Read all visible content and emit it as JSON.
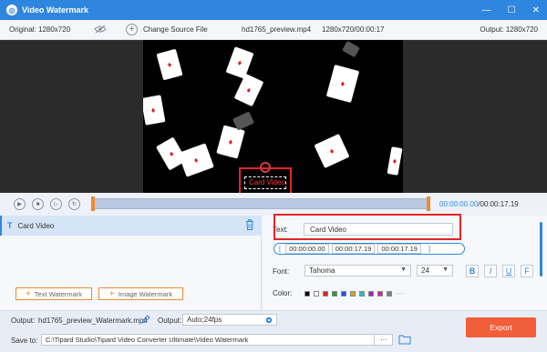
{
  "window": {
    "title": "Video Watermark",
    "controls": [
      "—",
      "☐",
      "✕"
    ]
  },
  "info": {
    "original": "Original: 1280x720",
    "change_source": "Change Source File",
    "filename": "hd1765_preview.mp4",
    "meta": "1280x720/00:00:17",
    "output_res": "Output: 1280x720"
  },
  "preview": {
    "watermark_text": "Card Video"
  },
  "playback": {
    "current": "00:00:00.00",
    "total": "/00:00:17.19"
  },
  "watermark_list": {
    "type_icon": "T",
    "items": [
      "Card Video"
    ]
  },
  "buttons": {
    "text_watermark": "Text Watermark",
    "image_watermark": "Image Watermark",
    "export": "Export"
  },
  "settings": {
    "text_label": "Text:",
    "text_value": "Card Video",
    "start": "00:00:00.00",
    "duration": "00:00:17.19",
    "end": "00:00:17.19",
    "font_label": "Font:",
    "font_value": "Tahoma",
    "size_value": "24",
    "color_label": "Color:",
    "bold": "B",
    "italic": "I",
    "underline": "U",
    "strike": "F",
    "colors": [
      "#000000",
      "#ffffff",
      "#e02020",
      "#20a020",
      "#2050e0",
      "#e0a020",
      "#20c0c0",
      "#a020c0",
      "#e020a0",
      "#808080"
    ]
  },
  "bottom": {
    "output_label": "Output:",
    "output_file": "hd1765_preview_Watermark.mp4",
    "output_format_label": "Output:",
    "output_format": "Auto;24fps",
    "save_label": "Save to:",
    "save_path": "C:\\Tipard Studio\\Tipard Video Converter Ultimate\\Video Watermark",
    "browse": "···"
  }
}
